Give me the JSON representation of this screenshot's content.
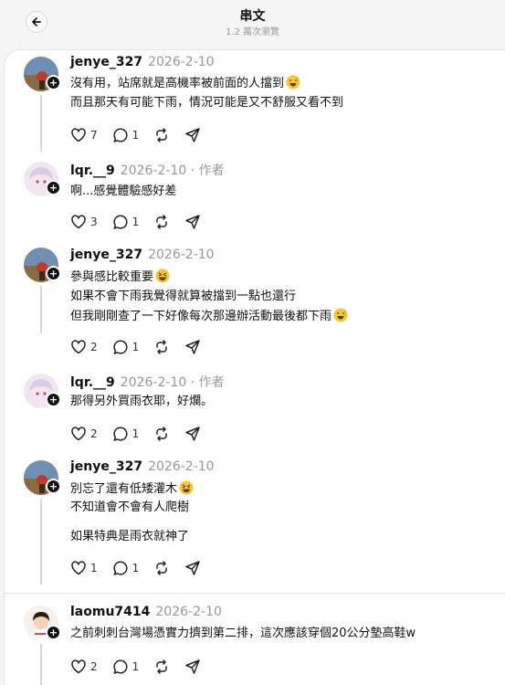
{
  "header": {
    "title": "串文",
    "views": "1.2 萬次瀏覽"
  },
  "posts": [
    {
      "username": "jenye_327",
      "date": "2026-2-10",
      "author_tag": "",
      "lines": [
        "沒有用，站席就是高機率被前面的人擋到",
        "而且那天有可能下雨，情況可能是又不舒服又看不到"
      ],
      "likes": "7",
      "replies": "1"
    },
    {
      "username": "lqr.__9",
      "date": "2026-2-10",
      "author_tag": "· 作者",
      "lines": [
        "啊...感覺體驗感好差"
      ],
      "likes": "3",
      "replies": "1"
    },
    {
      "username": "jenye_327",
      "date": "2026-2-10",
      "author_tag": "",
      "lines": [
        "參與感比較重要",
        "如果不會下雨我覺得就算被擋到一點也還行",
        "但我剛剛查了一下好像每次那邊辦活動最後都下雨"
      ],
      "likes": "2",
      "replies": "1"
    },
    {
      "username": "lqr.__9",
      "date": "2026-2-10",
      "author_tag": "· 作者",
      "lines": [
        "那得另外買雨衣耶，好爛。"
      ],
      "likes": "2",
      "replies": "1"
    },
    {
      "username": "jenye_327",
      "date": "2026-2-10",
      "author_tag": "",
      "lines": [
        "別忘了還有低矮灌木",
        "不知道會不會有人爬樹",
        "如果特典是雨衣就神了"
      ],
      "likes": "1",
      "replies": "1"
    },
    {
      "username": "laomu7414",
      "date": "2026-2-10",
      "author_tag": "",
      "lines": [
        "之前刺刺台灣場憑實力擠到第二排，這次應該穿個20公分墊高鞋w"
      ],
      "likes": "2",
      "replies": "1"
    }
  ],
  "icons": {
    "like": "heart-icon",
    "reply": "comment-icon",
    "repost": "repost-icon",
    "share": "send-icon",
    "back": "arrow-left-icon"
  }
}
